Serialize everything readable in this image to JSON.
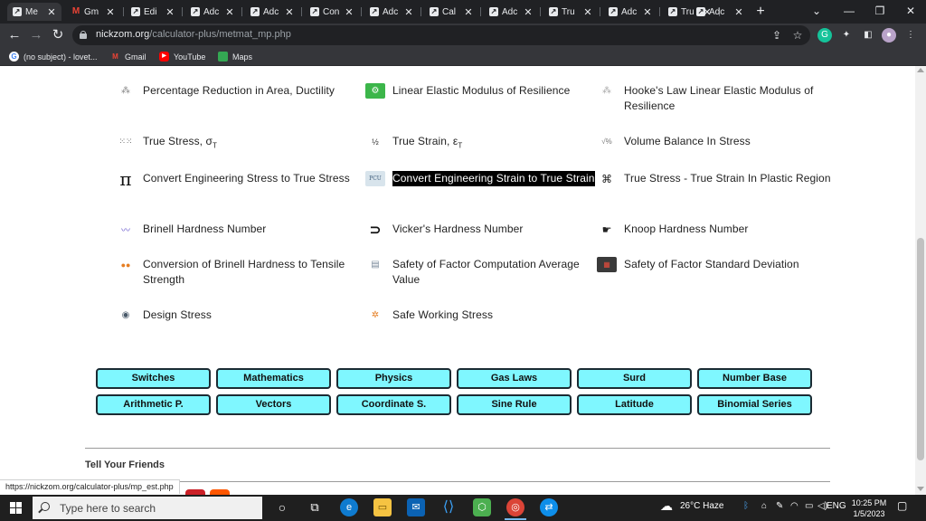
{
  "browser": {
    "tabs": [
      {
        "label": "Me",
        "icon": "nickzom-icon",
        "active": true
      },
      {
        "label": "Gm",
        "icon": "gmail-icon"
      },
      {
        "label": "Edi",
        "icon": "nickzom-icon"
      },
      {
        "label": "Adc",
        "icon": "nickzom-icon"
      },
      {
        "label": "Adc",
        "icon": "nickzom-icon"
      },
      {
        "label": "Con",
        "icon": "nickzom-icon"
      },
      {
        "label": "Adc",
        "icon": "nickzom-icon"
      },
      {
        "label": "Cal",
        "icon": "nickzom-icon"
      },
      {
        "label": "Adc",
        "icon": "nickzom-icon"
      },
      {
        "label": "Tru",
        "icon": "nickzom-icon"
      },
      {
        "label": "Adc",
        "icon": "nickzom-icon"
      },
      {
        "label": "Tru",
        "icon": "nickzom-icon"
      },
      {
        "label": "Adc",
        "icon": "nickzom-icon"
      }
    ],
    "url_domain": "nickzom.org",
    "url_path": "/calculator-plus/metmat_mp.php",
    "bookmarks": [
      {
        "label": "(no subject) - lovet...",
        "icon": "google-icon"
      },
      {
        "label": "Gmail",
        "icon": "gmail-icon"
      },
      {
        "label": "YouTube",
        "icon": "youtube-icon"
      },
      {
        "label": "Maps",
        "icon": "maps-icon"
      }
    ],
    "status_url": "https://nickzom.org/calculator-plus/mp_est.php"
  },
  "calculators": {
    "col1": [
      {
        "label": "Percentage Reduction in Area, Ductility",
        "icon": "molecule-icon"
      },
      {
        "label": "True Stress, σ",
        "sub": "T",
        "icon": "dots-grid-icon"
      },
      {
        "label": "Convert Engineering Stress to True Stress",
        "icon": "pi-icon"
      },
      {
        "label": "Brinell Hardness Number",
        "icon": "wave-icon"
      },
      {
        "label": "Conversion of Brinell Hardness to Tensile Strength",
        "icon": "colored-dots-icon"
      },
      {
        "label": "Design Stress",
        "icon": "disc-icon"
      }
    ],
    "col2": [
      {
        "label": "Linear Elastic Modulus of Resilience",
        "icon": "gear-icon"
      },
      {
        "label": "True Strain, ε",
        "sub": "T",
        "icon": "formula-icon"
      },
      {
        "label": "Convert Engineering Strain to True Strain",
        "icon": "pcu-icon",
        "highlighted": true
      },
      {
        "label": "Vicker's Hardness Number",
        "icon": "magnet-icon"
      },
      {
        "label": "Safety of Factor Computation Average Value",
        "icon": "chart-icon"
      },
      {
        "label": "Safe Working Stress",
        "icon": "people-circle-icon"
      }
    ],
    "col3": [
      {
        "label": "Hooke's Law Linear Elastic Modulus of Resilience",
        "icon": "molecule-icon"
      },
      {
        "label": "Volume Balance In Stress",
        "icon": "formula-icon"
      },
      {
        "label": "True Stress - True Strain In Plastic Region",
        "icon": "network-icon"
      },
      {
        "label": "Knoop Hardness Number",
        "icon": "hand-icon"
      },
      {
        "label": "Safety of Factor Standard Deviation",
        "icon": "dashboard-icon"
      }
    ]
  },
  "category_buttons": {
    "row1": [
      "Switches",
      "Mathematics",
      "Physics",
      "Gas Laws",
      "Surd",
      "Number Base"
    ],
    "row2": [
      "Arithmetic P.",
      "Vectors",
      "Coordinate S.",
      "Sine Rule",
      "Latitude",
      "Binomial Series"
    ]
  },
  "footer": {
    "tell_friends": "Tell Your Friends"
  },
  "taskbar": {
    "search_placeholder": "Type here to search",
    "weather": "26°C  Haze",
    "language": "ENG",
    "time": "10:25 PM",
    "date": "1/5/2023"
  },
  "pcu_text": "PCU",
  "colors": {
    "button_bg": "#7ff7ff",
    "highlight_bg": "#000000"
  }
}
